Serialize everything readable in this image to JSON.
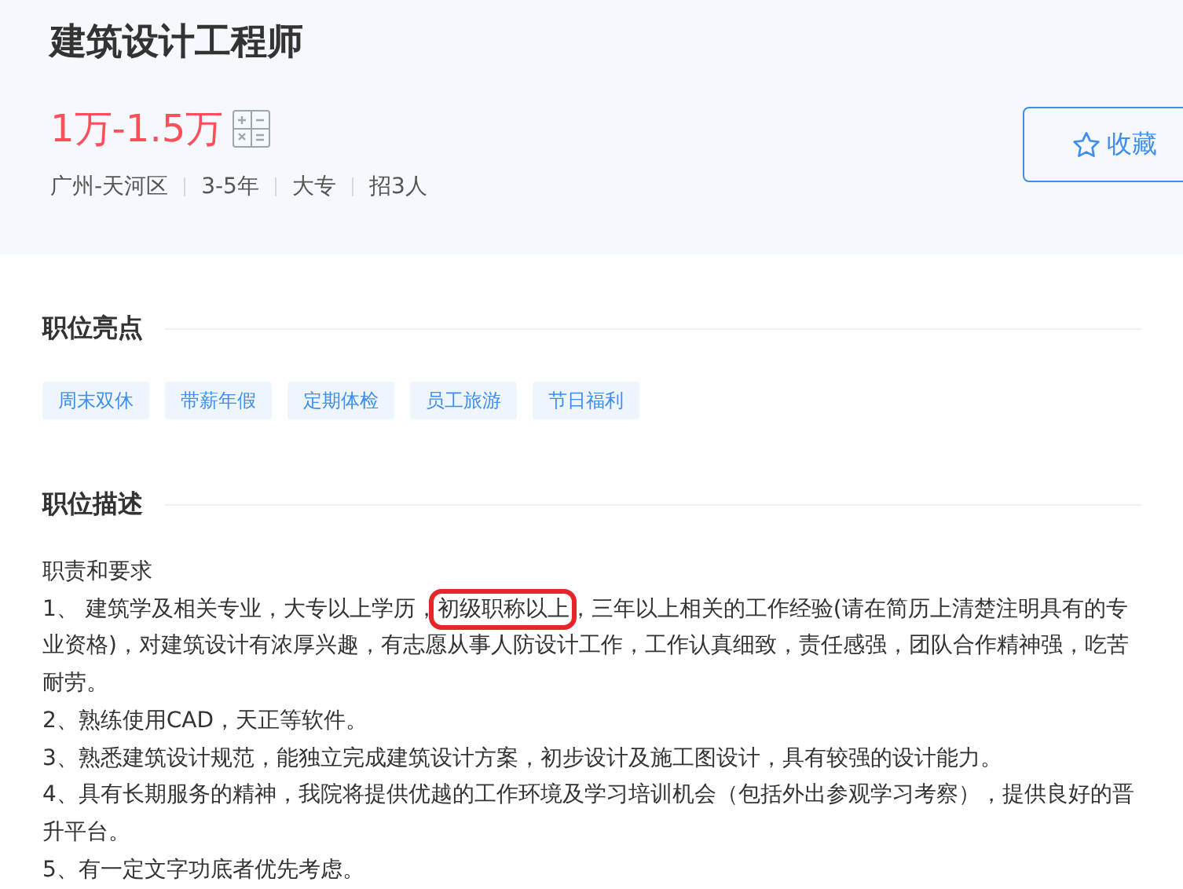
{
  "job": {
    "title": "建筑设计工程师",
    "salary": "1万-1.5万",
    "meta": [
      "广州-天河区",
      "3-5年",
      "大专",
      "招3人"
    ],
    "favorite_button": {
      "label": "收藏"
    }
  },
  "highlights": {
    "heading": "职位亮点",
    "tags": [
      "周末双休",
      "带薪年假",
      "定期体检",
      "员工旅游",
      "节日福利"
    ]
  },
  "description": {
    "heading": "职位描述",
    "lines": [
      {
        "text": "职责和要求"
      },
      {
        "text": "1、  建筑学及相关专业，大专以上学历，",
        "highlight": "初级职称以上",
        "after": "，三年以上相关的工作经验(请在简历上清楚注明具有的专业资格)，对建筑设计有浓厚兴趣，有志愿从事人防设计工作，工作认真细致，责任感强，团队合作精神强，吃苦耐劳。"
      },
      {
        "text": "2、熟练使用CAD，天正等软件。"
      },
      {
        "text": "3、熟悉建筑设计规范，能独立完成建筑设计方案，初步设计及施工图设计，具有较强的设计能力。"
      },
      {
        "text": "4、具有长期服务的精神，我院将提供优越的工作环境及学习培训机会（包括外出参观学习考察），提供良好的晋升平台。"
      },
      {
        "text": "5、有一定文字功底者优先考虑。"
      }
    ]
  }
}
